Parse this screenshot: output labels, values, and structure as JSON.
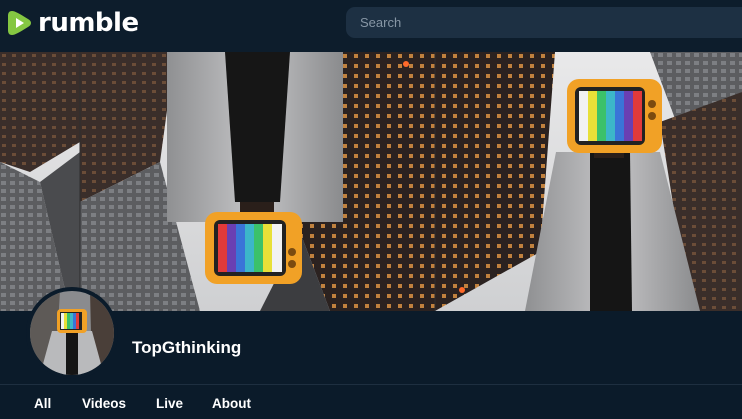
{
  "header": {
    "logo_text": "rumble",
    "search_placeholder": "Search"
  },
  "channel": {
    "name": "TopGthinking"
  },
  "tabs": [
    {
      "label": "All"
    },
    {
      "label": "Videos"
    },
    {
      "label": "Live"
    },
    {
      "label": "About"
    }
  ],
  "colors": {
    "brand_green": "#85c742",
    "background": "#0b1b2a",
    "search_bg": "#1d3043"
  }
}
